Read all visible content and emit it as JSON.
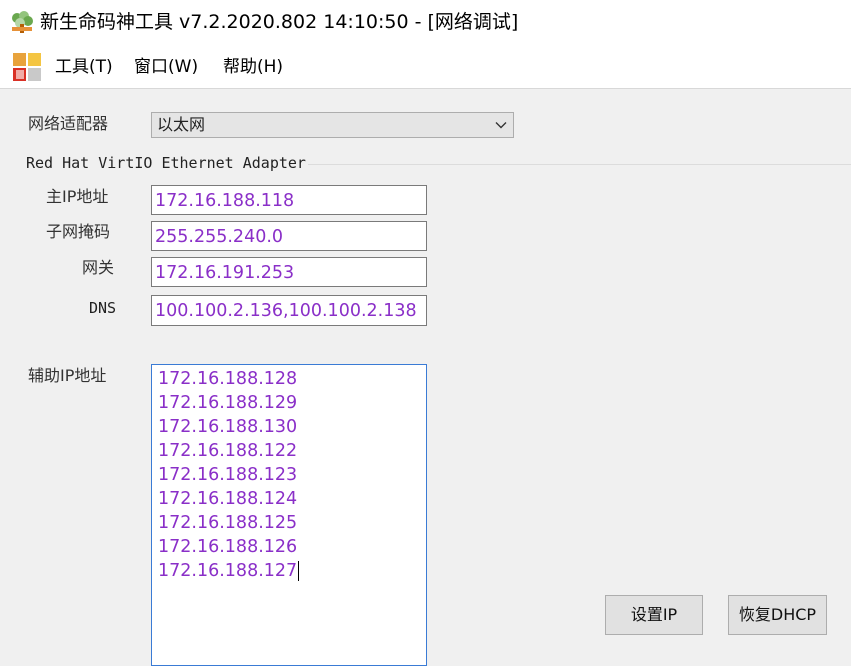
{
  "window": {
    "title": "新生命码神工具 v7.2.2020.802 14:10:50 - [网络调试]",
    "icon": "tree-app-icon"
  },
  "menu": {
    "logo": "windows-flag-icon",
    "items": [
      "工具(T)",
      "窗口(W)",
      "帮助(H)"
    ]
  },
  "form": {
    "adapter_label": "网络适配器",
    "adapter_selected": "以太网",
    "adapter_name": "Red Hat VirtIO Ethernet Adapter",
    "ip_label": "主IP地址",
    "ip_value": "172.16.188.118",
    "mask_label": "子网掩码",
    "mask_value": "255.255.240.0",
    "gateway_label": "网关",
    "gateway_value": "172.16.191.253",
    "dns_label": "DNS",
    "dns_value": "100.100.2.136,100.100.2.138",
    "aux_label": "辅助IP地址",
    "aux_ips": [
      "172.16.188.128",
      "172.16.188.129",
      "172.16.188.130",
      "172.16.188.122",
      "172.16.188.123",
      "172.16.188.124",
      "172.16.188.125",
      "172.16.188.126",
      "172.16.188.127"
    ]
  },
  "buttons": {
    "set_ip": "设置IP",
    "restore_dhcp": "恢复DHCP"
  },
  "colors": {
    "field_text": "#8a2fc8",
    "background": "#f0f0f0",
    "focus_border": "#3a7bd5"
  }
}
